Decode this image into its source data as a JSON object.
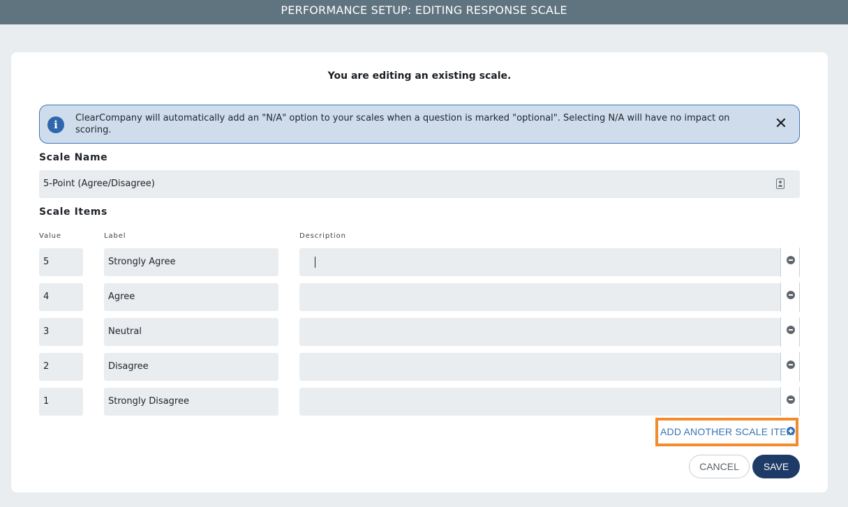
{
  "header": {
    "title": "PERFORMANCE SETUP: EDITING RESPONSE SCALE"
  },
  "card": {
    "heading": "You are editing an existing scale.",
    "banner": {
      "icon": "info-icon",
      "text": "ClearCompany will automatically add an \"N/A\" option to your scales when a question is marked \"optional\". Selecting N/A will have no impact on scoring.",
      "close_icon": "close-icon"
    },
    "scale_name": {
      "label": "Scale Name",
      "value": "5-Point (Agree/Disagree)"
    },
    "scale_items": {
      "label": "Scale Items",
      "columns": {
        "value": "Value",
        "label": "Label",
        "description": "Description"
      },
      "rows": [
        {
          "value": "5",
          "label": "Strongly Agree",
          "description": ""
        },
        {
          "value": "4",
          "label": "Agree",
          "description": ""
        },
        {
          "value": "3",
          "label": "Neutral",
          "description": ""
        },
        {
          "value": "2",
          "label": "Disagree",
          "description": ""
        },
        {
          "value": "1",
          "label": "Strongly Disagree",
          "description": ""
        }
      ]
    },
    "add_item_label": "ADD ANOTHER SCALE ITEM",
    "actions": {
      "cancel": "CANCEL",
      "save": "SAVE"
    }
  },
  "colors": {
    "header_bg": "#607480",
    "banner_bg": "#cfdcec",
    "banner_border": "#3d74b8",
    "highlight_border": "#f18b2e",
    "link_blue": "#3774b6",
    "save_bg": "#1d3b66"
  }
}
